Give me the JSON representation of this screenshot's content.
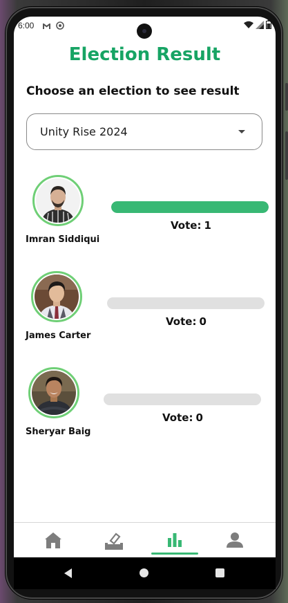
{
  "status_bar": {
    "time": "6:00",
    "left_icons": [
      "gmail-icon",
      "sync-icon"
    ],
    "right_icons": [
      "wifi-icon",
      "signal-icon",
      "battery-icon"
    ]
  },
  "header": {
    "title": "Election Result"
  },
  "election": {
    "prompt": "Choose an election to see result",
    "selected": "Unity Rise 2024"
  },
  "candidates": [
    {
      "name": "Imran Siddiqui",
      "vote_label": "Vote:",
      "votes": "1",
      "vote_share": 1.0
    },
    {
      "name": "James Carter",
      "vote_label": "Vote:",
      "votes": "0",
      "vote_share": 0.0
    },
    {
      "name": "Sheryar Baig",
      "vote_label": "Vote:",
      "votes": "0",
      "vote_share": 0.0
    }
  ],
  "bottom_nav": {
    "items": [
      {
        "icon": "home-icon"
      },
      {
        "icon": "ballot-icon"
      },
      {
        "icon": "bar-chart-icon",
        "active": true
      },
      {
        "icon": "profile-icon"
      }
    ]
  },
  "colors": {
    "accent": "#17a464",
    "bar_fill": "#38b874",
    "bar_track": "#e0e0e0",
    "avatar_ring": "#6fcf76"
  }
}
